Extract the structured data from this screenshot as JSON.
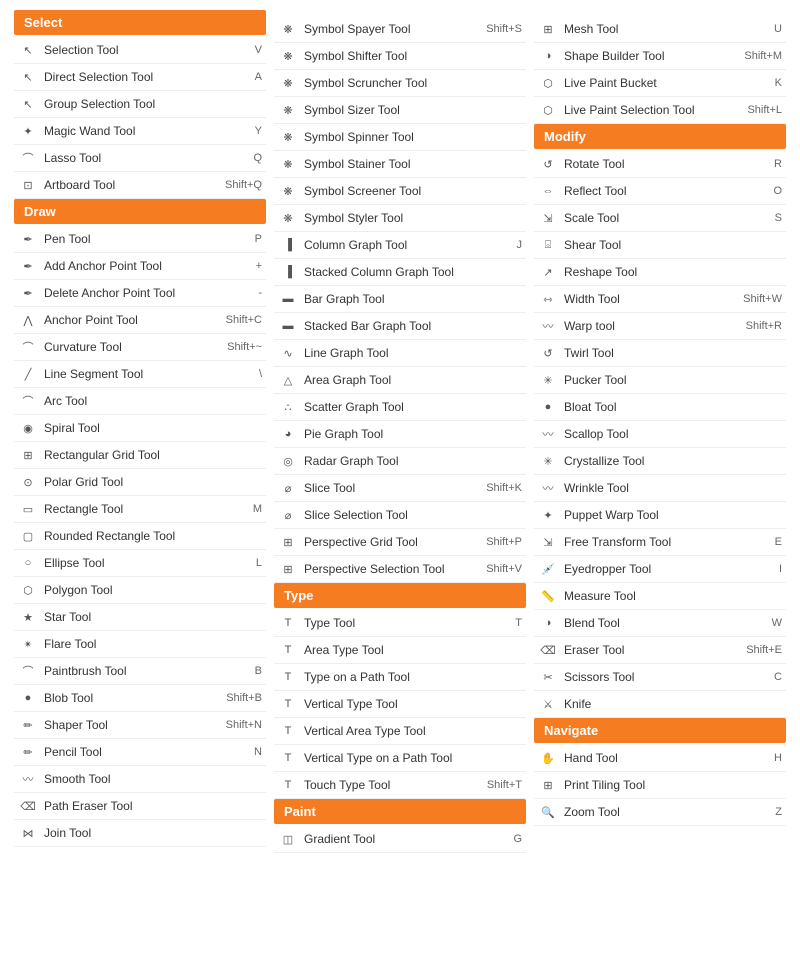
{
  "columns": [
    {
      "id": "col1",
      "sections": [
        {
          "header": "Select",
          "tools": [
            {
              "name": "Selection Tool",
              "shortcut": "V",
              "icon": "↖"
            },
            {
              "name": "Direct Selection Tool",
              "shortcut": "A",
              "icon": "↖"
            },
            {
              "name": "Group Selection Tool",
              "shortcut": "",
              "icon": "↖"
            },
            {
              "name": "Magic Wand Tool",
              "shortcut": "Y",
              "icon": "✦"
            },
            {
              "name": "Lasso Tool",
              "shortcut": "Q",
              "icon": "⌒"
            },
            {
              "name": "Artboard Tool",
              "shortcut": "Shift+Q",
              "icon": "⊞"
            }
          ]
        },
        {
          "header": "Draw",
          "tools": [
            {
              "name": "Pen Tool",
              "shortcut": "P",
              "icon": "✒"
            },
            {
              "name": "Add Anchor Point Tool",
              "shortcut": "+",
              "icon": "✒"
            },
            {
              "name": "Delete Anchor Point Tool",
              "shortcut": "-",
              "icon": "✒"
            },
            {
              "name": "Anchor Point Tool",
              "shortcut": "Shift+C",
              "icon": "⋀"
            },
            {
              "name": "Curvature Tool",
              "shortcut": "Shift+~",
              "icon": "⌒"
            },
            {
              "name": "Line Segment Tool",
              "shortcut": "\\",
              "icon": "╱"
            },
            {
              "name": "Arc Tool",
              "shortcut": "",
              "icon": "⌒"
            },
            {
              "name": "Spiral Tool",
              "shortcut": "",
              "icon": "@"
            },
            {
              "name": "Rectangular Grid Tool",
              "shortcut": "",
              "icon": "⊞"
            },
            {
              "name": "Polar Grid Tool",
              "shortcut": "",
              "icon": "⊙"
            },
            {
              "name": "Rectangle Tool",
              "shortcut": "M",
              "icon": "▭"
            },
            {
              "name": "Rounded Rectangle Tool",
              "shortcut": "",
              "icon": "▢"
            },
            {
              "name": "Ellipse Tool",
              "shortcut": "L",
              "icon": "○"
            },
            {
              "name": "Polygon Tool",
              "shortcut": "",
              "icon": "⬡"
            },
            {
              "name": "Star Tool",
              "shortcut": "",
              "icon": "★"
            },
            {
              "name": "Flare Tool",
              "shortcut": "",
              "icon": "✳"
            },
            {
              "name": "Paintbrush Tool",
              "shortcut": "B",
              "icon": "🖌"
            },
            {
              "name": "Blob Tool",
              "shortcut": "Shift+B",
              "icon": "●"
            },
            {
              "name": "Shaper Tool",
              "shortcut": "Shift+N",
              "icon": "✏"
            },
            {
              "name": "Pencil Tool",
              "shortcut": "N",
              "icon": "✏"
            },
            {
              "name": "Smooth Tool",
              "shortcut": "",
              "icon": "〰"
            },
            {
              "name": "Path Eraser Tool",
              "shortcut": "",
              "icon": "⌫"
            },
            {
              "name": "Join Tool",
              "shortcut": "",
              "icon": "⋈"
            }
          ]
        }
      ]
    },
    {
      "id": "col2",
      "sections": [
        {
          "header": null,
          "tools": [
            {
              "name": "Symbol Spayer Tool",
              "shortcut": "Shift+S",
              "icon": "❋"
            },
            {
              "name": "Symbol Shifter Tool",
              "shortcut": "",
              "icon": "❋"
            },
            {
              "name": "Symbol Scruncher Tool",
              "shortcut": "",
              "icon": "❋"
            },
            {
              "name": "Symbol Sizer Tool",
              "shortcut": "",
              "icon": "❋"
            },
            {
              "name": "Symbol Spinner Tool",
              "shortcut": "",
              "icon": "❋"
            },
            {
              "name": "Symbol Stainer Tool",
              "shortcut": "",
              "icon": "❋"
            },
            {
              "name": "Symbol Screener Tool",
              "shortcut": "",
              "icon": "❋"
            },
            {
              "name": "Symbol Styler Tool",
              "shortcut": "",
              "icon": "❋"
            },
            {
              "name": "Column Graph Tool",
              "shortcut": "J",
              "icon": "📊"
            },
            {
              "name": "Stacked Column Graph Tool",
              "shortcut": "",
              "icon": "📊"
            },
            {
              "name": "Bar Graph Tool",
              "shortcut": "",
              "icon": "📊"
            },
            {
              "name": "Stacked Bar Graph Tool",
              "shortcut": "",
              "icon": "📊"
            },
            {
              "name": "Line Graph Tool",
              "shortcut": "",
              "icon": "📈"
            },
            {
              "name": "Area Graph Tool",
              "shortcut": "",
              "icon": "📈"
            },
            {
              "name": "Scatter Graph Tool",
              "shortcut": "",
              "icon": "📈"
            },
            {
              "name": "Pie Graph Tool",
              "shortcut": "",
              "icon": "◑"
            },
            {
              "name": "Radar Graph Tool",
              "shortcut": "",
              "icon": "⬡"
            },
            {
              "name": "Slice Tool",
              "shortcut": "Shift+K",
              "icon": "⌀"
            },
            {
              "name": "Slice Selection Tool",
              "shortcut": "",
              "icon": "⌀"
            },
            {
              "name": "Perspective Grid Tool",
              "shortcut": "Shift+P",
              "icon": "⊞"
            },
            {
              "name": "Perspective Selection Tool",
              "shortcut": "Shift+V",
              "icon": "⊞"
            }
          ]
        },
        {
          "header": "Type",
          "tools": [
            {
              "name": "Type Tool",
              "shortcut": "T",
              "icon": "T"
            },
            {
              "name": "Area Type Tool",
              "shortcut": "",
              "icon": "T"
            },
            {
              "name": "Type on a Path Tool",
              "shortcut": "",
              "icon": "T"
            },
            {
              "name": "Vertical Type Tool",
              "shortcut": "",
              "icon": "T"
            },
            {
              "name": "Vertical Area Type Tool",
              "shortcut": "",
              "icon": "T"
            },
            {
              "name": "Vertical Type on a Path Tool",
              "shortcut": "",
              "icon": "T"
            },
            {
              "name": "Touch Type Tool",
              "shortcut": "Shift+T",
              "icon": "T"
            }
          ]
        },
        {
          "header": "Paint",
          "tools": [
            {
              "name": "Gradient Tool",
              "shortcut": "G",
              "icon": "◫"
            }
          ]
        }
      ]
    },
    {
      "id": "col3",
      "sections": [
        {
          "header": null,
          "tools": [
            {
              "name": "Mesh Tool",
              "shortcut": "U",
              "icon": "⊞"
            },
            {
              "name": "Shape Builder Tool",
              "shortcut": "Shift+M",
              "icon": "◑"
            },
            {
              "name": "Live Paint Bucket",
              "shortcut": "K",
              "icon": "🪣"
            },
            {
              "name": "Live Paint Selection Tool",
              "shortcut": "Shift+L",
              "icon": "🪣"
            }
          ]
        },
        {
          "header": "Modify",
          "tools": [
            {
              "name": "Rotate Tool",
              "shortcut": "R",
              "icon": "↺"
            },
            {
              "name": "Reflect Tool",
              "shortcut": "O",
              "icon": "⇔"
            },
            {
              "name": "Scale Tool",
              "shortcut": "S",
              "icon": "⇲"
            },
            {
              "name": "Shear Tool",
              "shortcut": "",
              "icon": "⌺"
            },
            {
              "name": "Reshape Tool",
              "shortcut": "",
              "icon": "↗"
            },
            {
              "name": "Width Tool",
              "shortcut": "Shift+W",
              "icon": "⇿"
            },
            {
              "name": "Warp tool",
              "shortcut": "Shift+R",
              "icon": "〰"
            },
            {
              "name": "Twirl Tool",
              "shortcut": "",
              "icon": "↺"
            },
            {
              "name": "Pucker Tool",
              "shortcut": "",
              "icon": "✳"
            },
            {
              "name": "Bloat Tool",
              "shortcut": "",
              "icon": "●"
            },
            {
              "name": "Scallop Tool",
              "shortcut": "",
              "icon": "〰"
            },
            {
              "name": "Crystallize Tool",
              "shortcut": "",
              "icon": "✳"
            },
            {
              "name": "Wrinkle Tool",
              "shortcut": "",
              "icon": "〰"
            },
            {
              "name": "Puppet Warp Tool",
              "shortcut": "",
              "icon": "✦"
            },
            {
              "name": "Free Transform Tool",
              "shortcut": "E",
              "icon": "⇲"
            },
            {
              "name": "Eyedropper Tool",
              "shortcut": "I",
              "icon": "💉"
            },
            {
              "name": "Measure Tool",
              "shortcut": "",
              "icon": "📏"
            },
            {
              "name": "Blend Tool",
              "shortcut": "W",
              "icon": "◑"
            },
            {
              "name": "Eraser Tool",
              "shortcut": "Shift+E",
              "icon": "⌫"
            },
            {
              "name": "Scissors Tool",
              "shortcut": "C",
              "icon": "✂"
            },
            {
              "name": "Knife",
              "shortcut": "",
              "icon": "⚔"
            }
          ]
        },
        {
          "header": "Navigate",
          "tools": [
            {
              "name": "Hand Tool",
              "shortcut": "H",
              "icon": "✋"
            },
            {
              "name": "Print Tiling Tool",
              "shortcut": "",
              "icon": "⊞"
            },
            {
              "name": "Zoom Tool",
              "shortcut": "Z",
              "icon": "🔍"
            }
          ]
        }
      ]
    }
  ]
}
